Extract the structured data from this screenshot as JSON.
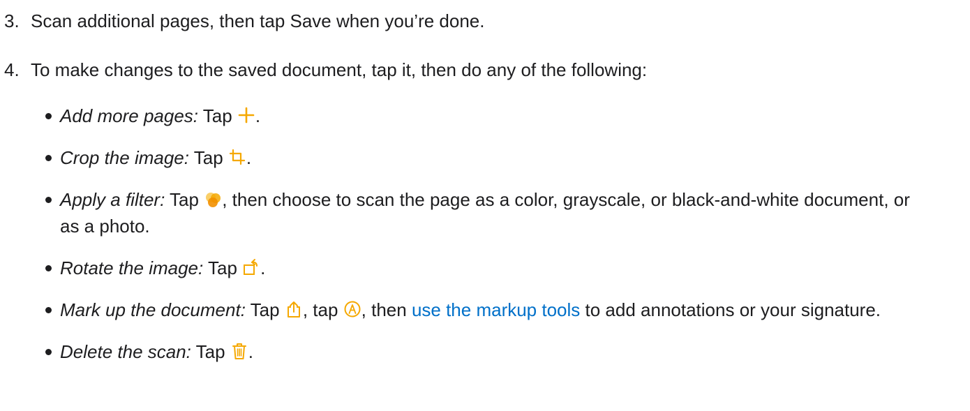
{
  "step3": {
    "number": "3.",
    "text": "Scan additional pages, then tap Save when you’re done."
  },
  "step4": {
    "number": "4.",
    "text": "To make changes to the saved document, tap it, then do any of the following:"
  },
  "bullets": [
    {
      "term": "Add more pages:",
      "before": " Tap ",
      "icon": "plus-icon",
      "after": "."
    },
    {
      "term": "Crop the image:",
      "before": " Tap ",
      "icon": "crop-icon",
      "after": "."
    },
    {
      "term": "Apply a filter:",
      "before": " Tap ",
      "icon": "filters-icon",
      "after": ", then choose to scan the page as a color, grayscale, or black-and-white document, or as a photo."
    },
    {
      "term": "Rotate the image:",
      "before": " Tap ",
      "icon": "rotate-icon",
      "after": "."
    },
    {
      "term": "Mark up the document:",
      "before": " Tap ",
      "icon": "share-icon",
      "middle": ", tap ",
      "icon2": "markup-icon",
      "middle2": ", then ",
      "link": "use the markup tools",
      "after": " to add annotations or your signature."
    },
    {
      "term": "Delete the scan:",
      "before": " Tap ",
      "icon": "trash-icon",
      "after": "."
    }
  ],
  "colors": {
    "icon_accent": "#f5a800",
    "link": "#0070c9",
    "text": "#1d1d1f"
  }
}
